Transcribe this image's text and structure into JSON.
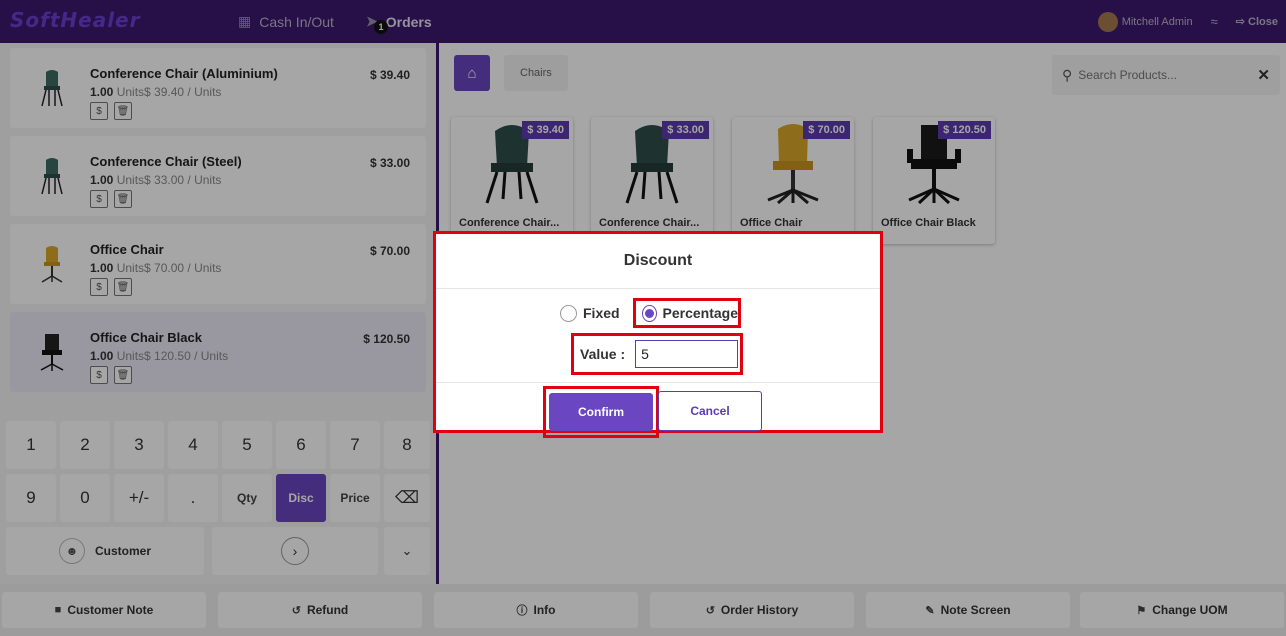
{
  "header": {
    "logo": "SoftHealer",
    "cash_label": "Cash In/Out",
    "orders_label": "Orders",
    "orders_badge": "1",
    "user_name": "Mitchell Admin",
    "close_label": "Close"
  },
  "order_lines": [
    {
      "name": "Conference Chair (Aluminium)",
      "qty": "1.00",
      "unit": "Units",
      "unit_price": "$ 39.40 / Units",
      "price": "$ 39.40"
    },
    {
      "name": "Conference Chair (Steel)",
      "qty": "1.00",
      "unit": "Units",
      "unit_price": "$ 33.00 / Units",
      "price": "$ 33.00"
    },
    {
      "name": "Office Chair",
      "qty": "1.00",
      "unit": "Units",
      "unit_price": "$ 70.00 / Units",
      "price": "$ 70.00"
    },
    {
      "name": "Office Chair Black",
      "qty": "1.00",
      "unit": "Units",
      "unit_price": "$ 120.50 / Units",
      "price": "$ 120.50"
    }
  ],
  "numpad": {
    "row1": [
      "1",
      "2",
      "3",
      "4",
      "5",
      "6",
      "7",
      "8"
    ],
    "row2": [
      "9",
      "0",
      "+/-",
      ".",
      "Qty",
      "Disc",
      "Price"
    ],
    "customer_label": "Customer"
  },
  "products": {
    "breadcrumb": "Chairs",
    "search_placeholder": "Search Products...",
    "items": [
      {
        "name": "Conference Chair...",
        "price": "$ 39.40"
      },
      {
        "name": "Conference Chair...",
        "price": "$ 33.00"
      },
      {
        "name": "Office Chair",
        "price": "$ 70.00"
      },
      {
        "name": "Office Chair Black",
        "price": "$ 120.50"
      }
    ]
  },
  "bottom_bar": [
    "Customer Note",
    "Refund",
    "Info",
    "Order History",
    "Note Screen",
    "Change UOM"
  ],
  "dialog": {
    "title": "Discount",
    "option_fixed": "Fixed",
    "option_percentage": "Percentage",
    "selected_option": "Percentage",
    "value_label": "Value :",
    "value": "5",
    "confirm_label": "Confirm",
    "cancel_label": "Cancel"
  },
  "colors": {
    "brand": "#3b1a6e",
    "accent": "#6b46c1",
    "highlight": "#e0000f"
  }
}
